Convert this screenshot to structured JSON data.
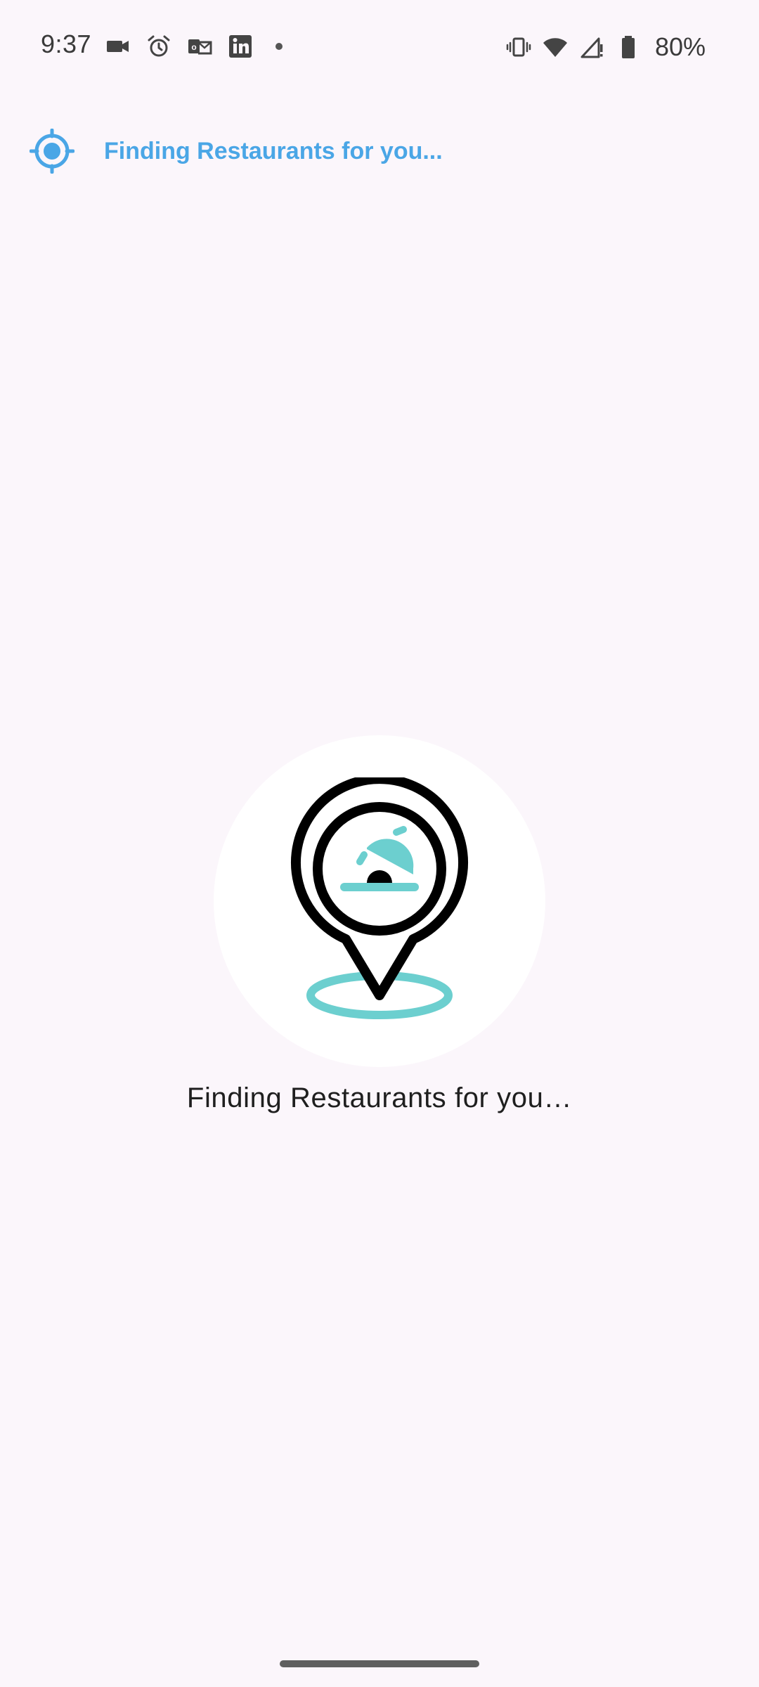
{
  "status_bar": {
    "time": "9:37",
    "left_icons": [
      "video-camera-icon",
      "alarm-clock-icon",
      "outlook-icon",
      "linkedin-icon",
      "notification-dot-icon"
    ],
    "right_icons": [
      "vibrate-icon",
      "wifi-icon",
      "signal-icon",
      "battery-icon"
    ],
    "battery_text": "80%"
  },
  "banner": {
    "icon": "locate-icon",
    "text": "Finding Restaurants for you...",
    "color": "#4aa6e6"
  },
  "loader": {
    "icon": "restaurant-location-pin-icon",
    "text": "Finding Restaurants for you…",
    "accent_color": "#6ccfcf"
  },
  "colors": {
    "background": "#fbf6fb",
    "accent": "#4aa6e6",
    "teal": "#6ccfcf"
  }
}
